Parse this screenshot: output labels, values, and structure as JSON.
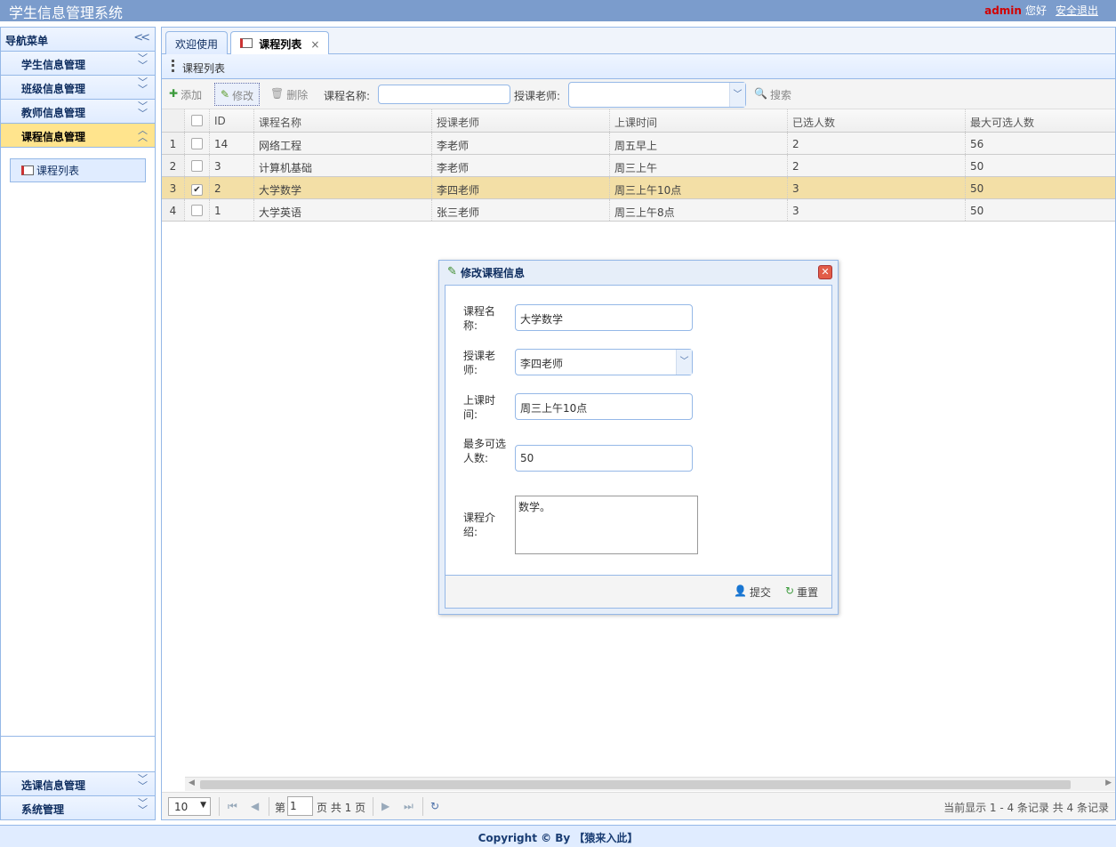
{
  "header": {
    "title": "学生信息管理系统",
    "user": "admin",
    "greeting": "您好",
    "logout": "安全退出"
  },
  "sidebar": {
    "title": "导航菜单",
    "items": [
      {
        "label": "学生信息管理"
      },
      {
        "label": "班级信息管理"
      },
      {
        "label": "教师信息管理"
      },
      {
        "label": "课程信息管理"
      }
    ],
    "submenu_item": "课程列表",
    "bottom_items": [
      {
        "label": "选课信息管理"
      },
      {
        "label": "系统管理"
      }
    ]
  },
  "tabs": [
    {
      "label": "欢迎使用"
    },
    {
      "label": "课程列表",
      "close": "×"
    }
  ],
  "panel": {
    "title": "课程列表"
  },
  "toolbar": {
    "add": "添加",
    "edit": "修改",
    "delete": "删除",
    "name_label": "课程名称:",
    "name_value": "",
    "teacher_label": "授课老师:",
    "teacher_value": "",
    "search": "搜索"
  },
  "table": {
    "headers": [
      "ID",
      "课程名称",
      "授课老师",
      "上课时间",
      "已选人数",
      "最大可选人数"
    ],
    "rows": [
      {
        "num": "1",
        "checked": false,
        "id": "14",
        "name": "网络工程",
        "teacher": "李老师",
        "time": "周五早上",
        "selected": "2",
        "max": "56"
      },
      {
        "num": "2",
        "checked": false,
        "id": "3",
        "name": "计算机基础",
        "teacher": "李老师",
        "time": "周三上午",
        "selected": "2",
        "max": "50"
      },
      {
        "num": "3",
        "checked": true,
        "id": "2",
        "name": "大学数学",
        "teacher": "李四老师",
        "time": "周三上午10点",
        "selected": "3",
        "max": "50"
      },
      {
        "num": "4",
        "checked": false,
        "id": "1",
        "name": "大学英语",
        "teacher": "张三老师",
        "time": "周三上午8点",
        "selected": "3",
        "max": "50"
      }
    ]
  },
  "pager": {
    "page_size": "10",
    "page_prefix": "第",
    "page_value": "1",
    "page_suffix": "页 共 1 页",
    "info": "当前显示 1 - 4 条记录 共 4 条记录"
  },
  "dialog": {
    "title": "修改课程信息",
    "fields": {
      "name_label": "课程名称:",
      "name_value": "大学数学",
      "teacher_label": "授课老师:",
      "teacher_value": "李四老师",
      "time_label": "上课时间:",
      "time_value": "周三上午10点",
      "max_label": "最多可选人数:",
      "max_value": "50",
      "intro_label": "课程介绍:",
      "intro_value": "数学。"
    },
    "submit": "提交",
    "reset": "重置"
  },
  "footer": {
    "text": "Copyright © By 【猿来入此】"
  },
  "colors": {
    "header_bg": "#7b9ccc",
    "border": "#95b8e7",
    "active_menu": "#ffe48d",
    "selected_row": "#f3dfa6",
    "user_red": "#d20000"
  }
}
